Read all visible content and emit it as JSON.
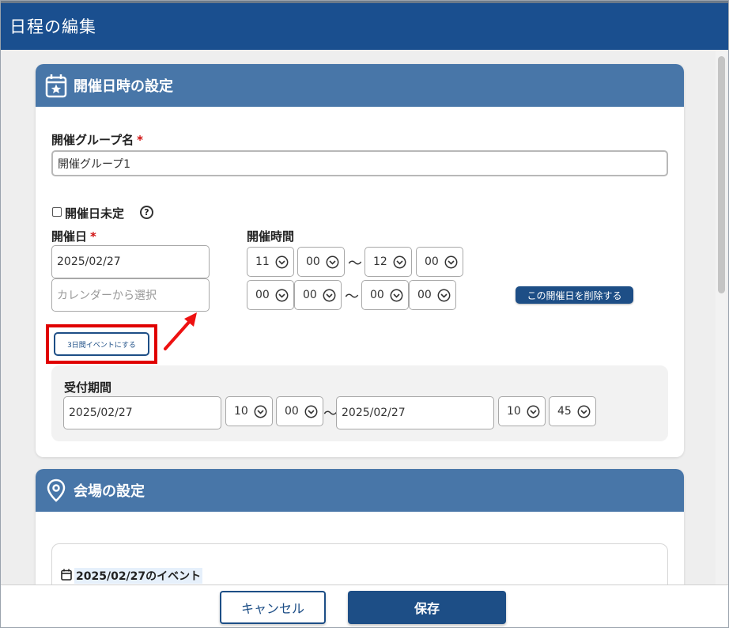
{
  "window": {
    "title": "日程の編集"
  },
  "datetime_section": {
    "header": "開催日時の設定",
    "group_name": {
      "label": "開催グループ名",
      "required_mark": "*",
      "value": "開催グループ1"
    },
    "undecided": {
      "label": "開催日未定",
      "checked": false,
      "help_glyph": "?"
    },
    "date_label": "開催日",
    "date_required_mark": "*",
    "time_label": "開催時間",
    "rows": [
      {
        "date": "2025/02/27",
        "date_placeholder": "",
        "start_hour": "11",
        "start_min": "00",
        "end_hour": "12",
        "end_min": "00"
      },
      {
        "date": "",
        "date_placeholder": "カレンダーから選択",
        "start_hour": "00",
        "start_min": "00",
        "end_hour": "00",
        "end_min": "00"
      }
    ],
    "tilde": "〜",
    "delete_button": "この開催日を削除する",
    "three_day_button": "3日間イベントにする",
    "reception": {
      "label": "受付期間",
      "start_date": "2025/02/27",
      "start_hour": "10",
      "start_min": "00",
      "end_date": "2025/02/27",
      "end_hour": "10",
      "end_min": "45"
    }
  },
  "venue_section": {
    "header": "会場の設定",
    "event_title": "2025/02/27のイベント"
  },
  "footer": {
    "cancel": "キャンセル",
    "save": "保存"
  },
  "colors": {
    "titlebar": "#1a4f8f",
    "section_header": "#4876a8",
    "primary_button": "#1d4e86",
    "highlight": "#e00000"
  }
}
